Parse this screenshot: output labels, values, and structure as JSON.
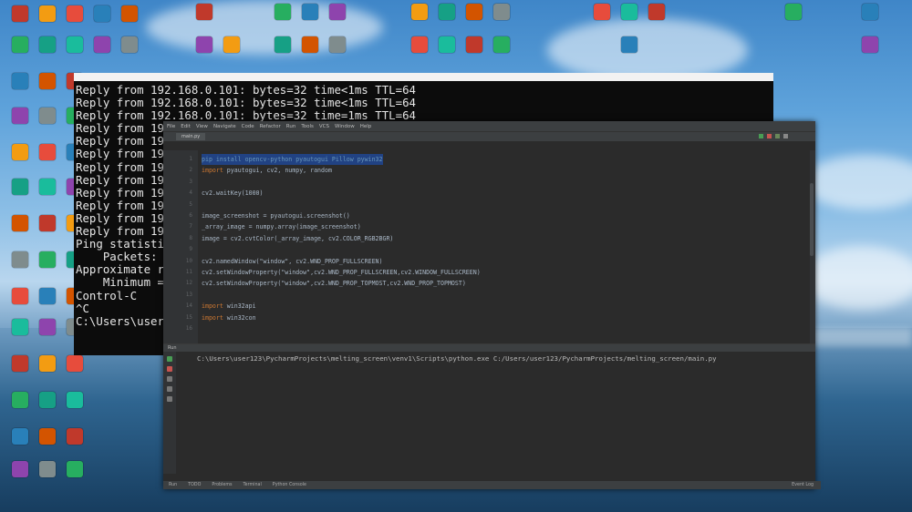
{
  "console": {
    "title": "",
    "lines": [
      "Reply from 192.168.0.101: bytes=32 time<1ms TTL=64",
      "Reply from 192.168.0.101: bytes=32 time<1ms TTL=64",
      "Reply from 192.168.0.101: bytes=32 time=1ms TTL=64",
      "Reply from 192.168.0.101: bytes=32 time<1ms TTL=64",
      "Reply from 192.",
      "Reply from 192.",
      "Reply from 192.",
      "Reply from 192.",
      "Reply from 192.",
      "Reply from 192.",
      "Reply from 192.",
      "Reply from 192.",
      "",
      "Ping statistics",
      "    Packets: Se",
      "Approximate rou",
      "    Minimum = 0",
      "Control-C",
      "^C",
      "C:\\Users\\user12"
    ]
  },
  "ide": {
    "menu": [
      "File",
      "Edit",
      "View",
      "Navigate",
      "Code",
      "Refactor",
      "Run",
      "Tools",
      "VCS",
      "Window",
      "Help"
    ],
    "tab_label": "main.py",
    "code": [
      {
        "n": "1",
        "text": "pip install opencv-python pyautogui Pillow pywin32",
        "style": "sel"
      },
      {
        "n": "2",
        "text": "import pyautogui, cv2, numpy, random",
        "style": "kwline"
      },
      {
        "n": "3",
        "text": "",
        "style": ""
      },
      {
        "n": "4",
        "text": "cv2.waitKey(1000)",
        "style": ""
      },
      {
        "n": "5",
        "text": "",
        "style": ""
      },
      {
        "n": "6",
        "text": "image_screenshot = pyautogui.screenshot()",
        "style": ""
      },
      {
        "n": "7",
        "text": "_array_image = numpy.array(image_screenshot)",
        "style": ""
      },
      {
        "n": "8",
        "text": "image = cv2.cvtColor(_array_image, cv2.COLOR_RGB2BGR)",
        "style": ""
      },
      {
        "n": "9",
        "text": "",
        "style": ""
      },
      {
        "n": "10",
        "text": "cv2.namedWindow(\"window\", cv2.WND_PROP_FULLSCREEN)",
        "style": ""
      },
      {
        "n": "11",
        "text": "cv2.setWindowProperty(\"window\",cv2.WND_PROP_FULLSCREEN,cv2.WINDOW_FULLSCREEN)",
        "style": ""
      },
      {
        "n": "12",
        "text": "cv2.setWindowProperty(\"window\",cv2.WND_PROP_TOPMOST,cv2.WND_PROP_TOPMOST)",
        "style": ""
      },
      {
        "n": "13",
        "text": "",
        "style": ""
      },
      {
        "n": "14",
        "text": "import win32api",
        "style": "kwline"
      },
      {
        "n": "15",
        "text": "import win32con",
        "style": "kwline"
      },
      {
        "n": "16",
        "text": "",
        "style": ""
      }
    ],
    "run_header": "Run",
    "run_command": "C:\\Users\\user123\\PycharmProjects\\melting_screen\\venv1\\Scripts\\python.exe C:/Users/user123/PycharmProjects/melting_screen/main.py",
    "status_items": [
      "Run",
      "TODO",
      "Problems",
      "Terminal",
      "Python Console"
    ],
    "status_right": "Event Log"
  },
  "colors": {
    "accent": "#214283",
    "keyword": "#cc7832",
    "ide_bg": "#2b2b2b",
    "console_bg": "#0c0c0c"
  }
}
